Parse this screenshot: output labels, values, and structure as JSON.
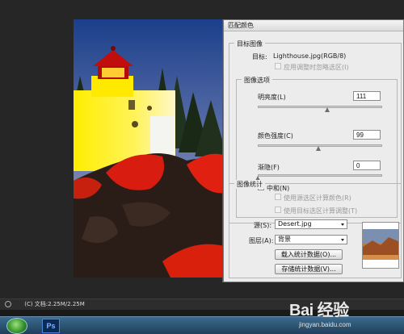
{
  "status_bar": {
    "doc_info": "(C) 文档:2.25M/2.25M"
  },
  "taskbar": {
    "app_icon_label": "Ps"
  },
  "watermark": {
    "brand": "Bai 经验",
    "url": "jingyan.baidu.com"
  },
  "dialog": {
    "title": "匹配颜色",
    "target_group": {
      "title": "目标图像",
      "target_label": "目标:",
      "target_value": "Lighthouse.jpg(RGB/8)",
      "ignore_selection_label": "应用调整时忽略选区(I)"
    },
    "image_options": {
      "title": "图像选项",
      "luminance": {
        "label": "明亮度(L)",
        "value": "111",
        "fraction": 0.56
      },
      "color_intensity": {
        "label": "颜色强度(C)",
        "value": "99",
        "fraction": 0.49
      },
      "fade": {
        "label": "渐隐(F)",
        "value": "0",
        "fraction": 0.0
      },
      "neutralize_label": "中和(N)"
    },
    "image_stats": {
      "title": "图像统计",
      "use_source_selection_label": "使用源选区计算颜色(R)",
      "use_target_selection_label": "使用目标选区计算调整(T)",
      "source_label": "源(S):",
      "source_value": "Desert.jpg",
      "layer_label": "图层(A):",
      "layer_value": "背景",
      "load_stats_button": "载入统计数据(O)...",
      "save_stats_button": "存储统计数据(V)..."
    }
  }
}
